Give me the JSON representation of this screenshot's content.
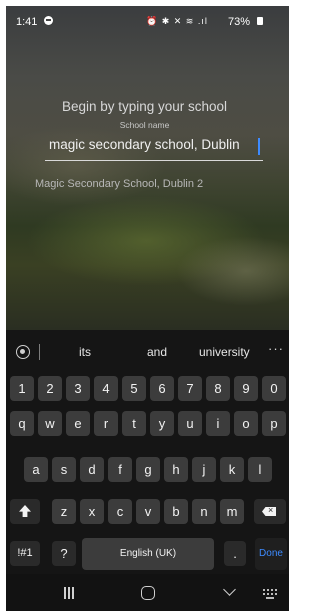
{
  "status_bar": {
    "time": "1:41",
    "icons": "⏰ ✱ ✕ ≋ .ıl",
    "battery": "73%"
  },
  "app": {
    "heading": "Begin by typing your school",
    "field_label": "School name",
    "input_value": "magic secondary school, Dublin",
    "suggestion": "Magic Secondary School, Dublin 2"
  },
  "keyboard": {
    "suggestions": [
      "its",
      "and",
      "university"
    ],
    "more_label": "···",
    "row_numbers": [
      "1",
      "2",
      "3",
      "4",
      "5",
      "6",
      "7",
      "8",
      "9",
      "0"
    ],
    "row_top": [
      "q",
      "w",
      "e",
      "r",
      "t",
      "y",
      "u",
      "i",
      "o",
      "p"
    ],
    "row_mid": [
      "a",
      "s",
      "d",
      "f",
      "g",
      "h",
      "j",
      "k",
      "l"
    ],
    "row_bottom": [
      "z",
      "x",
      "c",
      "v",
      "b",
      "n",
      "m"
    ],
    "symbols_key": "!#1",
    "question_key": "?",
    "space_label": "English (UK)",
    "period_key": ".",
    "done_key": "Done"
  },
  "colors": {
    "accent": "#3d8bff",
    "keyboard_bg": "#151515",
    "key_bg": "#3c3c3c"
  }
}
